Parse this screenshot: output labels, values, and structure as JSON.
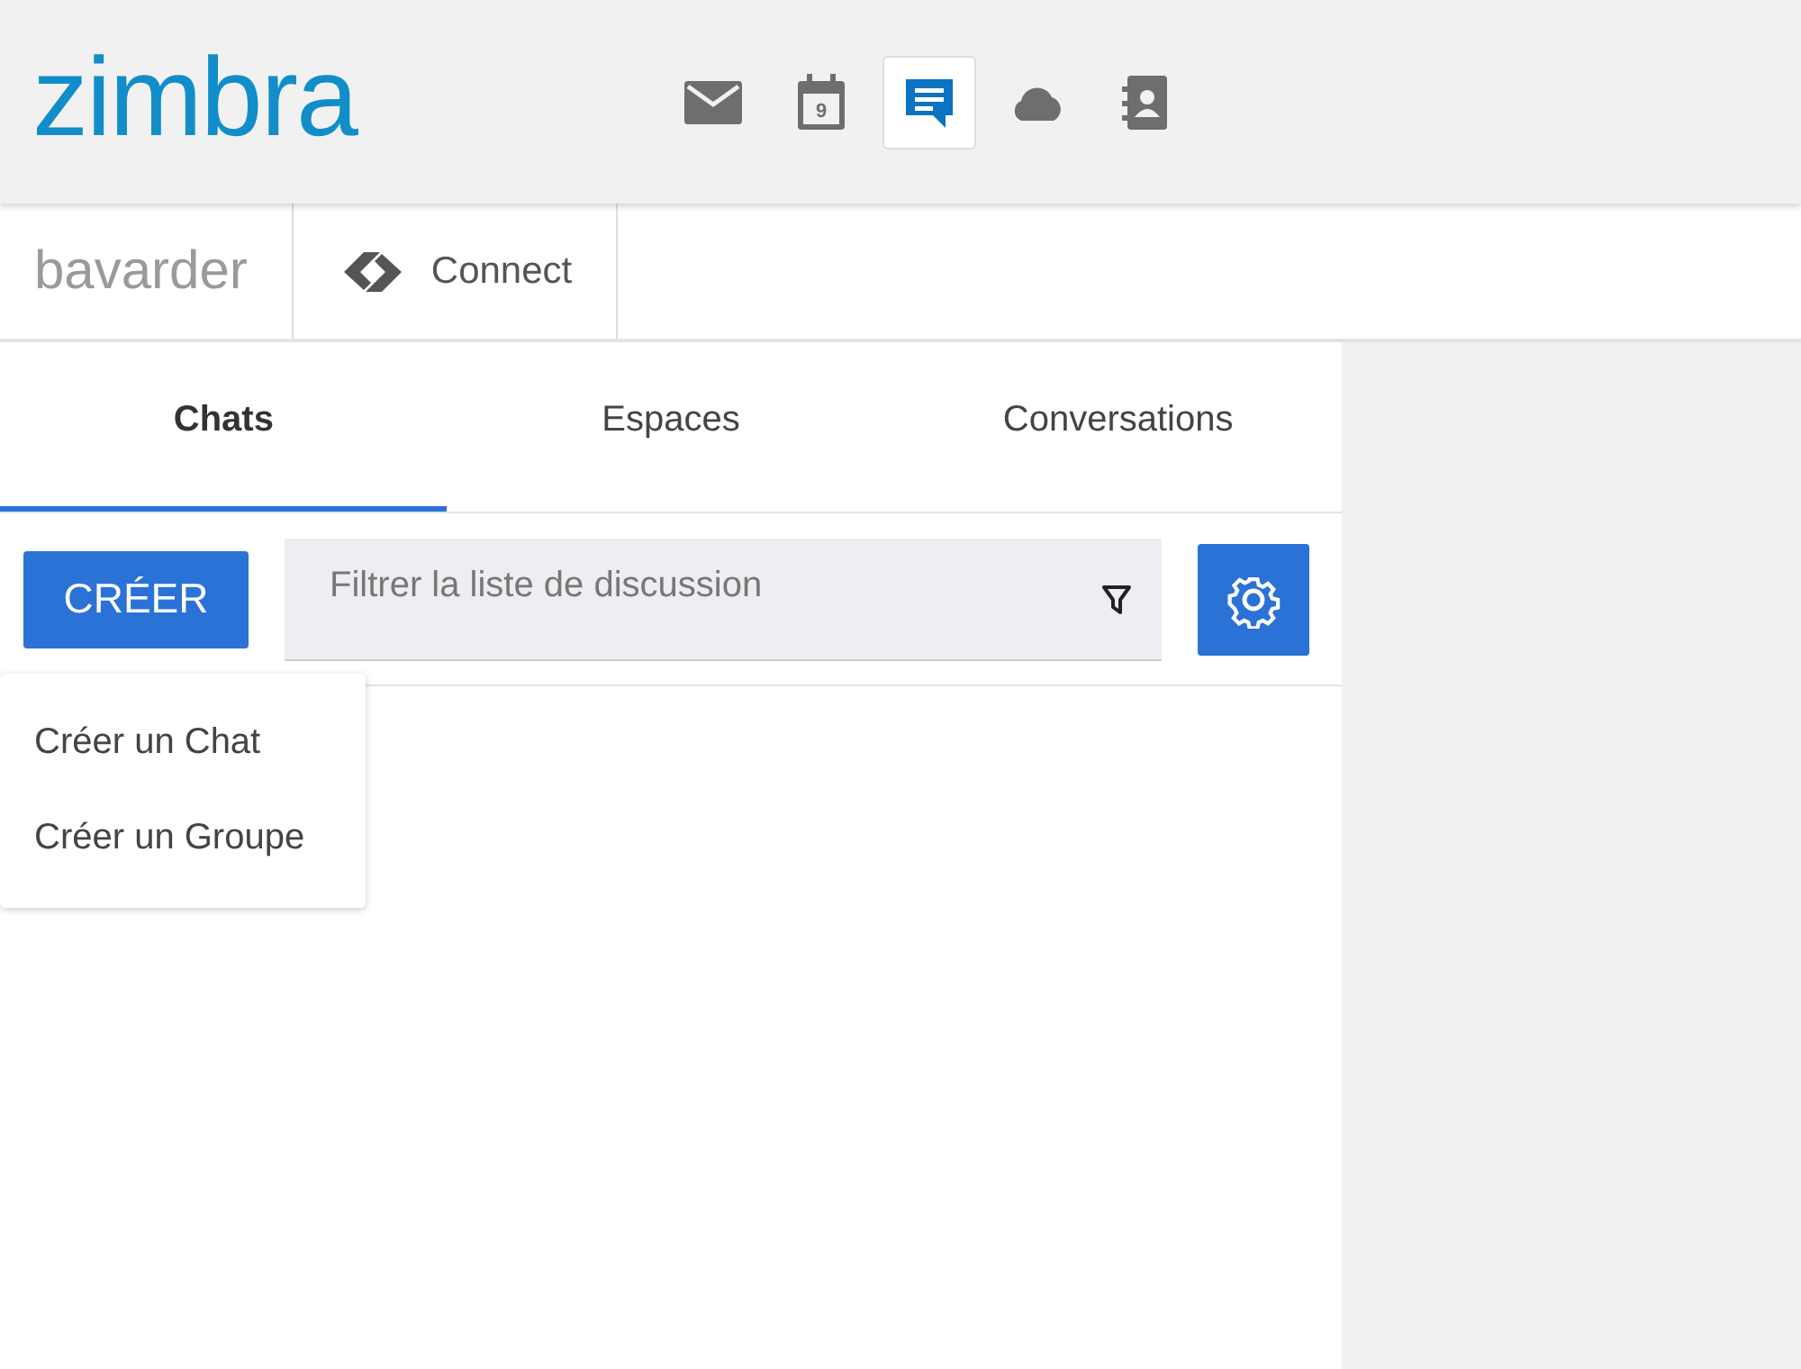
{
  "header": {
    "logo": "zimbra",
    "apps": [
      {
        "kind": "mail",
        "selected": false
      },
      {
        "kind": "calendar",
        "day": "9",
        "selected": false
      },
      {
        "kind": "chat",
        "selected": true
      },
      {
        "kind": "cloud",
        "selected": false
      },
      {
        "kind": "contacts",
        "selected": false
      }
    ]
  },
  "subheader": {
    "title": "bavarder",
    "connect": "Connect"
  },
  "tabs": [
    {
      "label": "Chats",
      "selected": true
    },
    {
      "label": "Espaces",
      "selected": false
    },
    {
      "label": "Conversations",
      "selected": false
    }
  ],
  "toolbar": {
    "create_button": "CRÉER",
    "filter": {
      "placeholder": "Filtrer la liste de discussion"
    }
  },
  "create_menu": {
    "items": [
      "Créer un Chat",
      "Créer un Groupe"
    ]
  }
}
